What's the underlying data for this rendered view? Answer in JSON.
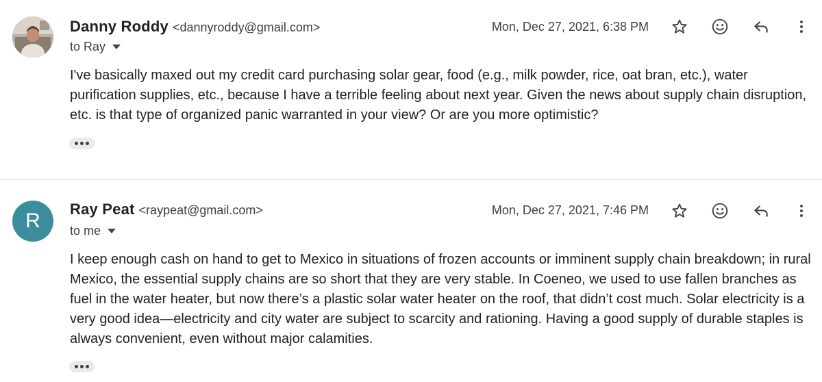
{
  "messages": [
    {
      "sender_name": "Danny Roddy",
      "sender_email": "<dannyroddy@gmail.com>",
      "recipient": "to Ray",
      "timestamp": "Mon, Dec 27, 2021, 6:38 PM",
      "avatar": {
        "type": "photo",
        "color": "#c9c2bb"
      },
      "body": "I've basically maxed out my credit card purchasing solar gear, food (e.g., milk powder, rice, oat bran, etc.), water purification supplies, etc., because I have a terrible feeling about next year. Given the news about supply chain disruption, etc. is that type of organized panic warranted in your view? Or are you more optimistic?"
    },
    {
      "sender_name": "Ray Peat",
      "sender_email": "<raypeat@gmail.com>",
      "recipient": "to me",
      "timestamp": "Mon, Dec 27, 2021, 7:46 PM",
      "avatar": {
        "type": "letter",
        "letter": "R",
        "color": "#3b8d9c"
      },
      "body": "I keep enough cash on hand to get to Mexico in situations of frozen accounts or imminent supply chain breakdown; in rural Mexico, the essential supply chains are so short that they are very stable. In Coeneo, we used to use fallen branches as fuel in the water heater, but now there’s a plastic solar water heater on the roof, that didn’t cost much. Solar electricity is a very good idea—electricity and city water are subject to scarcity and rationing. Having a good supply of durable staples is always convenient, even without major calamities."
    }
  ],
  "icons": {
    "star": "star-icon",
    "emoji": "emoji-icon",
    "reply": "reply-icon",
    "more": "more-vert-icon",
    "expand": "ellipsis-icon"
  }
}
